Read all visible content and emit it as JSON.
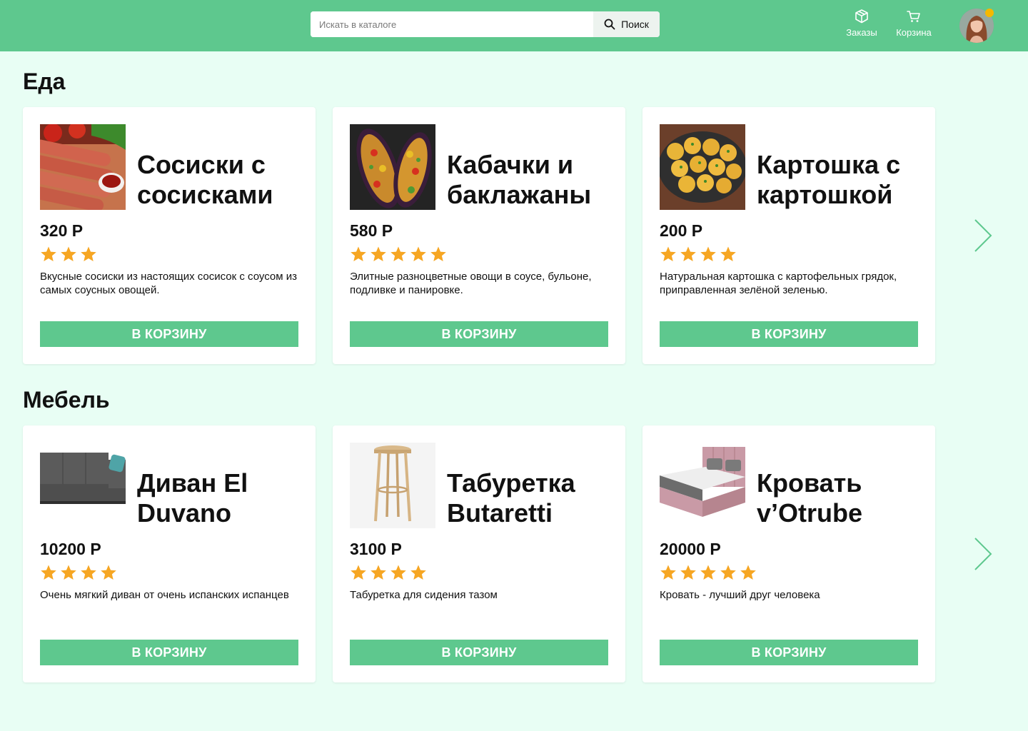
{
  "header": {
    "search_placeholder": "Искать в каталоге",
    "search_button": "Поиск",
    "orders_label": "Заказы",
    "cart_label": "Корзина"
  },
  "colors": {
    "header": "#5ec88e",
    "background": "#e8fef4",
    "button": "#5ec88e",
    "star": "#f6a623"
  },
  "sections": [
    {
      "title": "Еда",
      "products": [
        {
          "name": "Сосиски с сосисками",
          "price": "320 Р",
          "rating": 3,
          "description": "Вкусные сосиски из настоящих сосисок с соусом из самых соусных овощей.",
          "button": "В КОРЗИНУ",
          "image": "sausages"
        },
        {
          "name": "Кабачки и баклажаны",
          "price": "580 Р",
          "rating": 5,
          "description": "Элитные разноцветные овощи в соусе, бульоне, подливке и панировке.",
          "button": "В КОРЗИНУ",
          "image": "stuffed-eggplant"
        },
        {
          "name": "Картошка с картошкой",
          "price": "200 Р",
          "rating": 4,
          "description": "Натуральная картошка с картофельных грядок, приправленная зелёной зеленью.",
          "button": "В КОРЗИНУ",
          "image": "potatoes"
        }
      ]
    },
    {
      "title": "Мебель",
      "products": [
        {
          "name": "Диван El Duvano",
          "price": "10200 Р",
          "rating": 4,
          "description": "Очень мягкий диван от очень испанских испанцев",
          "button": "В КОРЗИНУ",
          "image": "sofa"
        },
        {
          "name": "Табуретка Butaretti",
          "price": "3100 Р",
          "rating": 4,
          "description": "Табуретка для сидения тазом",
          "button": "В КОРЗИНУ",
          "image": "stool"
        },
        {
          "name": "Кровать v’Otrube",
          "price": "20000 Р",
          "rating": 5,
          "description": "Кровать - лучший друг человека",
          "button": "В КОРЗИНУ",
          "image": "bed"
        }
      ]
    }
  ]
}
